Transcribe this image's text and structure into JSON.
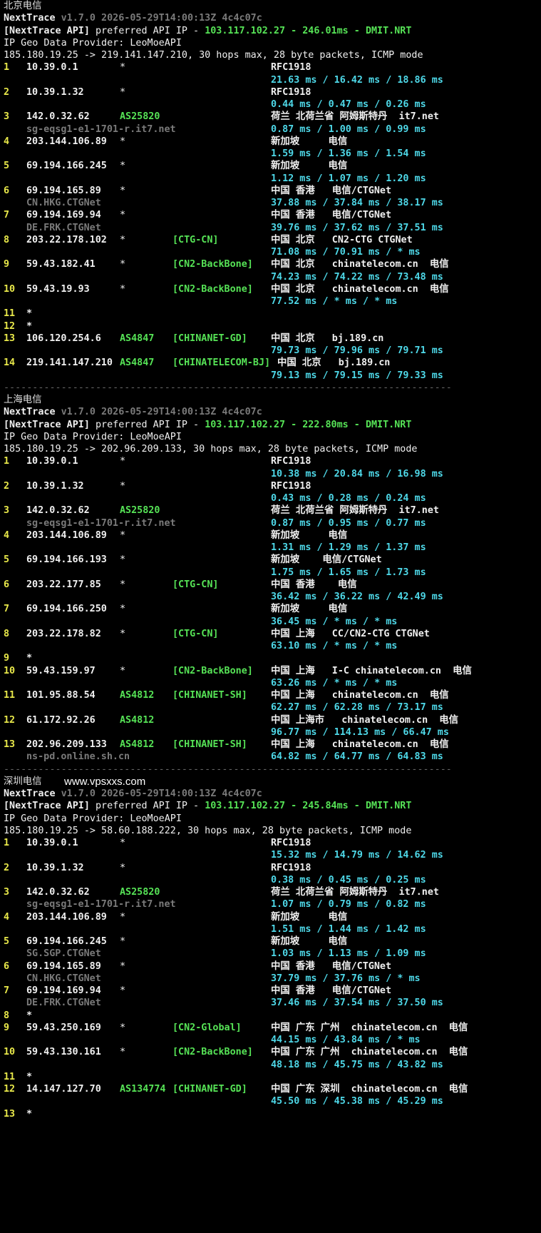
{
  "watermark": "www.vpsxxs.com",
  "separator": "------------------------------------------------------------------------------",
  "sections": [
    {
      "title": "北京电信",
      "nt_name": "NextTrace",
      "nt_version": "v1.7.0 2026-05-29T14:00:13Z 4c4c07c",
      "api_label": "[NextTrace API]",
      "api_text": " preferred API IP - ",
      "api_ip": "103.117.102.27",
      "api_sep": " - ",
      "api_ms": "246.01ms",
      "api_sep2": " - ",
      "api_node": "DMIT.NRT",
      "geo_line": "IP Geo Data Provider: LeoMoeAPI",
      "trace_line": "185.180.19.25 -> 219.141.147.210, 30 hops max, 28 byte packets, ICMP mode",
      "hops": [
        {
          "n": "1",
          "ip": "10.39.0.1",
          "asn": "*",
          "tag": "",
          "geo": "RFC1918",
          "ms": "21.63 ms / 16.42 ms / 18.86 ms",
          "host": ""
        },
        {
          "n": "2",
          "ip": "10.39.1.32",
          "asn": "*",
          "tag": "",
          "geo": "RFC1918",
          "ms": "0.44 ms / 0.47 ms / 0.26 ms",
          "host": ""
        },
        {
          "n": "3",
          "ip": "142.0.32.62",
          "asn": "AS25820",
          "tag": "",
          "geo": "荷兰 北荷兰省 阿姆斯特丹  it7.net",
          "ms": "0.87 ms / 1.00 ms / 0.99 ms",
          "host": "sg-eqsg1-e1-1701-r.it7.net"
        },
        {
          "n": "4",
          "ip": "203.144.106.89",
          "asn": "*",
          "tag": "",
          "geo": "新加坡     电信",
          "ms": "1.59 ms / 1.36 ms / 1.54 ms",
          "host": ""
        },
        {
          "n": "5",
          "ip": "69.194.166.245",
          "asn": "*",
          "tag": "",
          "geo": "新加坡     电信",
          "ms": "1.12 ms / 1.07 ms / 1.20 ms",
          "host": ""
        },
        {
          "n": "6",
          "ip": "69.194.165.89",
          "asn": "*",
          "tag": "",
          "geo": "中国 香港   电信/CTGNet",
          "ms": "37.88 ms / 37.84 ms / 38.17 ms",
          "host": "CN.HKG.CTGNet"
        },
        {
          "n": "7",
          "ip": "69.194.169.94",
          "asn": "*",
          "tag": "",
          "geo": "中国 香港   电信/CTGNet",
          "ms": "39.76 ms / 37.62 ms / 37.51 ms",
          "host": "DE.FRK.CTGNet"
        },
        {
          "n": "8",
          "ip": "203.22.178.102",
          "asn": "*",
          "tag": "[CTG-CN]",
          "geo": "中国 北京   CN2-CTG CTGNet",
          "ms": "71.08 ms / 70.91 ms / * ms",
          "host": ""
        },
        {
          "n": "9",
          "ip": "59.43.182.41",
          "asn": "*",
          "tag": "[CN2-BackBone]",
          "geo": "中国 北京   chinatelecom.cn  电信",
          "ms": "74.23 ms / 74.22 ms / 73.48 ms",
          "host": ""
        },
        {
          "n": "10",
          "ip": "59.43.19.93",
          "asn": "*",
          "tag": "[CN2-BackBone]",
          "geo": "中国 北京   chinatelecom.cn  电信",
          "ms": "77.52 ms / * ms / * ms",
          "host": ""
        },
        {
          "n": "11",
          "ip": "*",
          "asn": "",
          "tag": "",
          "geo": "",
          "ms": "",
          "host": ""
        },
        {
          "n": "12",
          "ip": "*",
          "asn": "",
          "tag": "",
          "geo": "",
          "ms": "",
          "host": ""
        },
        {
          "n": "13",
          "ip": "106.120.254.6",
          "asn": "AS4847",
          "tag": "[CHINANET-GD]",
          "geo": "中国 北京   bj.189.cn",
          "ms": "79.73 ms / 79.96 ms / 79.71 ms",
          "host": ""
        },
        {
          "n": "14",
          "ip": "219.141.147.210",
          "asn": "AS4847",
          "tag": "[CHINATELECOM-BJ]",
          "geo": "中国 北京   bj.189.cn",
          "ms": "79.13 ms / 79.15 ms / 79.33 ms",
          "host": ""
        }
      ]
    },
    {
      "title": "上海电信",
      "nt_name": "NextTrace",
      "nt_version": "v1.7.0 2026-05-29T14:00:13Z 4c4c07c",
      "api_label": "[NextTrace API]",
      "api_text": " preferred API IP - ",
      "api_ip": "103.117.102.27",
      "api_sep": " - ",
      "api_ms": "222.80ms",
      "api_sep2": " - ",
      "api_node": "DMIT.NRT",
      "geo_line": "IP Geo Data Provider: LeoMoeAPI",
      "trace_line": "185.180.19.25 -> 202.96.209.133, 30 hops max, 28 byte packets, ICMP mode",
      "hops": [
        {
          "n": "1",
          "ip": "10.39.0.1",
          "asn": "*",
          "tag": "",
          "geo": "RFC1918",
          "ms": "10.38 ms / 20.84 ms / 16.98 ms",
          "host": ""
        },
        {
          "n": "2",
          "ip": "10.39.1.32",
          "asn": "*",
          "tag": "",
          "geo": "RFC1918",
          "ms": "0.43 ms / 0.28 ms / 0.24 ms",
          "host": ""
        },
        {
          "n": "3",
          "ip": "142.0.32.62",
          "asn": "AS25820",
          "tag": "",
          "geo": "荷兰 北荷兰省 阿姆斯特丹  it7.net",
          "ms": "0.87 ms / 0.95 ms / 0.77 ms",
          "host": "sg-eqsg1-e1-1701-r.it7.net"
        },
        {
          "n": "4",
          "ip": "203.144.106.89",
          "asn": "*",
          "tag": "",
          "geo": "新加坡     电信",
          "ms": "1.31 ms / 1.29 ms / 1.37 ms",
          "host": ""
        },
        {
          "n": "5",
          "ip": "69.194.166.193",
          "asn": "*",
          "tag": "",
          "geo": "新加坡    电信/CTGNet",
          "ms": "1.75 ms / 1.65 ms / 1.73 ms",
          "host": ""
        },
        {
          "n": "6",
          "ip": "203.22.177.85",
          "asn": "*",
          "tag": "[CTG-CN]",
          "geo": "中国 香港    电信",
          "ms": "36.42 ms / 36.22 ms / 42.49 ms",
          "host": ""
        },
        {
          "n": "7",
          "ip": "69.194.166.250",
          "asn": "*",
          "tag": "",
          "geo": "新加坡     电信",
          "ms": "36.45 ms / * ms / * ms",
          "host": ""
        },
        {
          "n": "8",
          "ip": "203.22.178.82",
          "asn": "*",
          "tag": "[CTG-CN]",
          "geo": "中国 上海   CC/CN2-CTG CTGNet",
          "ms": "63.10 ms / * ms / * ms",
          "host": ""
        },
        {
          "n": "9",
          "ip": "*",
          "asn": "",
          "tag": "",
          "geo": "",
          "ms": "",
          "host": ""
        },
        {
          "n": "10",
          "ip": "59.43.159.97",
          "asn": "*",
          "tag": "[CN2-BackBone]",
          "geo": "中国 上海   I-C chinatelecom.cn  电信",
          "ms": "63.26 ms / * ms / * ms",
          "host": ""
        },
        {
          "n": "11",
          "ip": "101.95.88.54",
          "asn": "AS4812",
          "tag": "[CHINANET-SH]",
          "geo": "中国 上海   chinatelecom.cn  电信",
          "ms": "62.27 ms / 62.28 ms / 73.17 ms",
          "host": ""
        },
        {
          "n": "12",
          "ip": "61.172.92.26",
          "asn": "AS4812",
          "tag": "",
          "geo": "中国 上海市   chinatelecom.cn  电信",
          "ms": "96.77 ms / 114.13 ms / 66.47 ms",
          "host": ""
        },
        {
          "n": "13",
          "ip": "202.96.209.133",
          "asn": "AS4812",
          "tag": "[CHINANET-SH]",
          "geo": "中国 上海   chinatelecom.cn  电信",
          "ms": "64.82 ms / 64.77 ms / 64.83 ms",
          "host": "ns-pd.online.sh.cn"
        }
      ]
    },
    {
      "title": "深圳电信",
      "nt_name": "NextTrace",
      "nt_version": "v1.7.0 2026-05-29T14:00:13Z 4c4c07c",
      "api_label": "[NextTrace API]",
      "api_text": " preferred API IP - ",
      "api_ip": "103.117.102.27",
      "api_sep": " - ",
      "api_ms": "245.84ms",
      "api_sep2": " - ",
      "api_node": "DMIT.NRT",
      "geo_line": "IP Geo Data Provider: LeoMoeAPI",
      "trace_line": "185.180.19.25 -> 58.60.188.222, 30 hops max, 28 byte packets, ICMP mode",
      "hops": [
        {
          "n": "1",
          "ip": "10.39.0.1",
          "asn": "*",
          "tag": "",
          "geo": "RFC1918",
          "ms": "15.32 ms / 14.79 ms / 14.62 ms",
          "host": ""
        },
        {
          "n": "2",
          "ip": "10.39.1.32",
          "asn": "*",
          "tag": "",
          "geo": "RFC1918",
          "ms": "0.38 ms / 0.45 ms / 0.25 ms",
          "host": ""
        },
        {
          "n": "3",
          "ip": "142.0.32.62",
          "asn": "AS25820",
          "tag": "",
          "geo": "荷兰 北荷兰省 阿姆斯特丹  it7.net",
          "ms": "1.07 ms / 0.79 ms / 0.82 ms",
          "host": "sg-eqsg1-e1-1701-r.it7.net"
        },
        {
          "n": "4",
          "ip": "203.144.106.89",
          "asn": "*",
          "tag": "",
          "geo": "新加坡     电信",
          "ms": "1.51 ms / 1.44 ms / 1.42 ms",
          "host": ""
        },
        {
          "n": "5",
          "ip": "69.194.166.245",
          "asn": "*",
          "tag": "",
          "geo": "新加坡     电信",
          "ms": "1.03 ms / 1.13 ms / 1.09 ms",
          "host": "SG.SGP.CTGNet"
        },
        {
          "n": "6",
          "ip": "69.194.165.89",
          "asn": "*",
          "tag": "",
          "geo": "中国 香港   电信/CTGNet",
          "ms": "37.79 ms / 37.76 ms / * ms",
          "host": "CN.HKG.CTGNet"
        },
        {
          "n": "7",
          "ip": "69.194.169.94",
          "asn": "*",
          "tag": "",
          "geo": "中国 香港   电信/CTGNet",
          "ms": "37.46 ms / 37.54 ms / 37.50 ms",
          "host": "DE.FRK.CTGNet"
        },
        {
          "n": "8",
          "ip": "*",
          "asn": "",
          "tag": "",
          "geo": "",
          "ms": "",
          "host": ""
        },
        {
          "n": "9",
          "ip": "59.43.250.169",
          "asn": "*",
          "tag": "[CN2-Global]",
          "geo": "中国 广东 广州  chinatelecom.cn  电信",
          "ms": "44.15 ms / 43.84 ms / * ms",
          "host": ""
        },
        {
          "n": "10",
          "ip": "59.43.130.161",
          "asn": "*",
          "tag": "[CN2-BackBone]",
          "geo": "中国 广东 广州  chinatelecom.cn  电信",
          "ms": "48.18 ms / 45.75 ms / 43.82 ms",
          "host": ""
        },
        {
          "n": "11",
          "ip": "*",
          "asn": "",
          "tag": "",
          "geo": "",
          "ms": "",
          "host": ""
        },
        {
          "n": "12",
          "ip": "14.147.127.70",
          "asn": "AS134774",
          "tag": "[CHINANET-GD]",
          "geo": "中国 广东 深圳  chinatelecom.cn  电信",
          "ms": "45.50 ms / 45.38 ms / 45.29 ms",
          "host": ""
        },
        {
          "n": "13",
          "ip": "*",
          "asn": "",
          "tag": "",
          "geo": "",
          "ms": "",
          "host": ""
        }
      ]
    }
  ]
}
